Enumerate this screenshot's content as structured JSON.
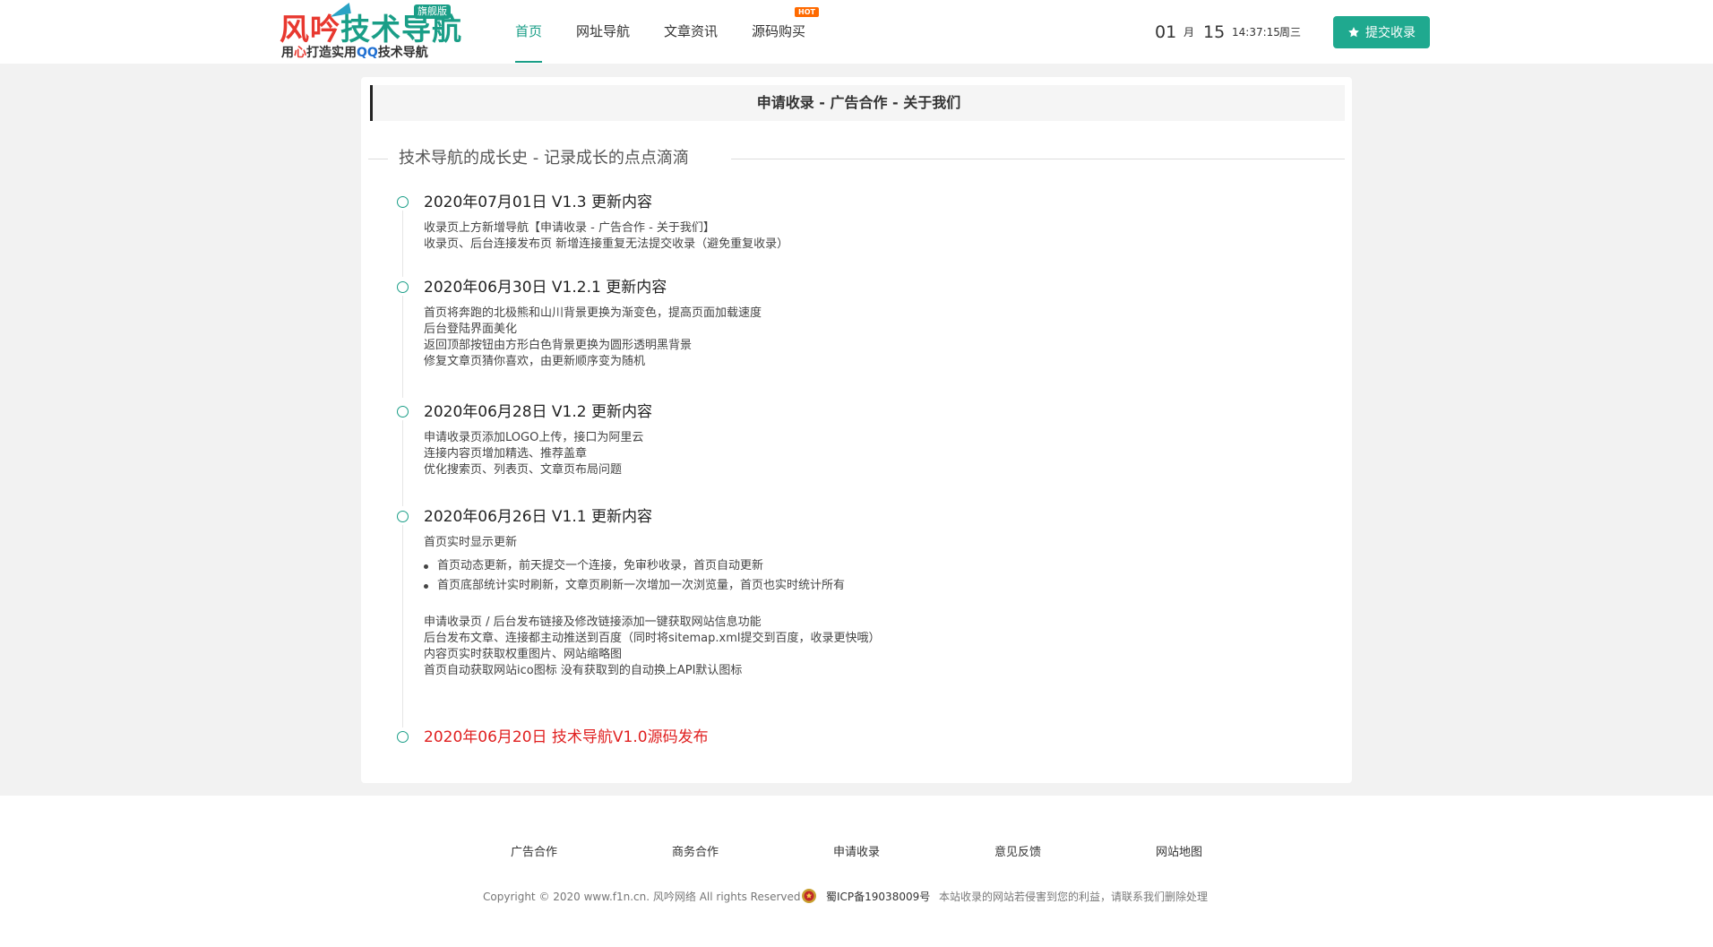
{
  "logo": {
    "title_part1": "风吟",
    "title_part2": "技术导航",
    "badge": "旗舰版",
    "subtitle_part1": "用",
    "subtitle_part2": "心",
    "subtitle_part3": "打造实用",
    "subtitle_part4": "QQ",
    "subtitle_part5": "技术导航"
  },
  "nav": {
    "items": [
      {
        "label": "首页",
        "active": true
      },
      {
        "label": "网址导航",
        "active": false
      },
      {
        "label": "文章资讯",
        "active": false
      },
      {
        "label": "源码购买",
        "active": false
      }
    ],
    "hot_badge": "HOT"
  },
  "clock": {
    "month": "01",
    "month_unit": "月",
    "day": "15",
    "time": "14:37:15",
    "weekday": "周三"
  },
  "submit_button": {
    "label": "提交收录",
    "icon": "star-icon"
  },
  "banner": {
    "text": "申请收录 - 广告合作 - 关于我们"
  },
  "section_title": "技术导航的成长史 - 记录成长的点点滴滴",
  "timeline": [
    {
      "title": "2020年07月01日 V1.3 更新内容",
      "lines": [
        "收录页上方新增导航【申请收录 - 广告合作 - 关于我们】",
        "收录页、后台连接发布页 新增连接重复无法提交收录（避免重复收录）"
      ]
    },
    {
      "title": "2020年06月30日 V1.2.1 更新内容",
      "lines": [
        "首页将奔跑的北极熊和山川背景更换为渐变色，提高页面加载速度",
        "后台登陆界面美化",
        "返回顶部按钮由方形白色背景更换为圆形透明黑背景",
        "修复文章页猜你喜欢，由更新顺序变为随机"
      ]
    },
    {
      "title": "2020年06月28日 V1.2 更新内容",
      "lines": [
        "申请收录页添加LOGO上传，接口为阿里云",
        "连接内容页增加精选、推荐盖章",
        "优化搜索页、列表页、文章页布局问题"
      ]
    },
    {
      "title": "2020年06月26日 V1.1 更新内容",
      "intro": "首页实时显示更新",
      "bullets": [
        "首页动态更新，前天提交一个连接，免审秒收录，首页自动更新",
        "首页底部统计实时刷新，文章页刷新一次增加一次浏览量，首页也实时统计所有"
      ],
      "lines": [
        "申请收录页 / 后台发布链接及修改链接添加一键获取网站信息功能",
        "后台发布文章、连接都主动推送到百度（同时将sitemap.xml提交到百度，收录更快哦）",
        "内容页实时获取权重图片、网站缩略图",
        "首页自动获取网站ico图标 没有获取到的自动换上API默认图标"
      ]
    },
    {
      "title": "2020年06月20日 技术导航V1.0源码发布",
      "highlight_color": "#e02020"
    }
  ],
  "footer": {
    "links": [
      "广告合作",
      "商务合作",
      "申请收录",
      "意见反馈",
      "网站地图"
    ],
    "copyright": "Copyright © 2020 www.f1n.cn. 风吟网络 All rights Reserved",
    "icp": "蜀ICP备19038009号",
    "notice": "本站收录的网站若侵害到您的利益，请联系我们删除处理"
  },
  "colors": {
    "accent": "#1a9e87",
    "button": "#1fa98f",
    "highlight": "#e02020",
    "hot": "#ff6a00"
  }
}
